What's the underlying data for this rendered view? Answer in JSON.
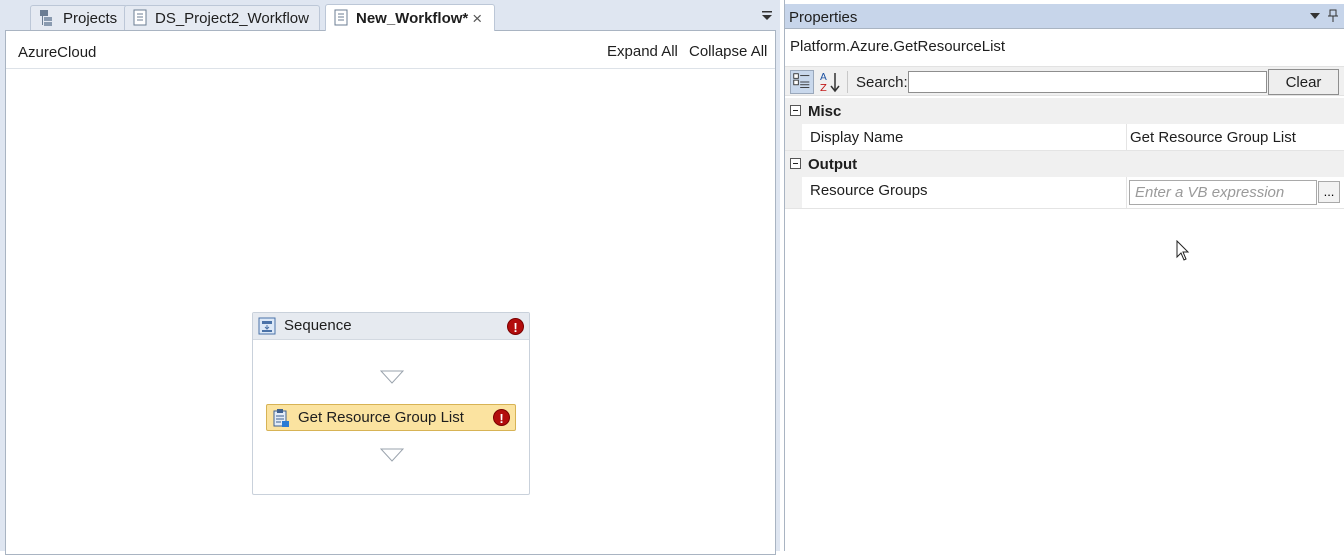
{
  "tabs": [
    {
      "label": "Projects",
      "icon": "project-tree-icon"
    },
    {
      "label": "DS_Project2_Workflow",
      "icon": "workflow-doc-icon"
    },
    {
      "label": "New_Workflow*",
      "icon": "workflow-doc-icon",
      "active": true
    }
  ],
  "tab_close": "×",
  "designer": {
    "breadcrumb": "AzureCloud",
    "expand_all": "Expand All",
    "collapse_all": "Collapse All",
    "sequence": {
      "title": "Sequence",
      "error_glyph": "!",
      "activity": {
        "title": "Get Resource Group List",
        "error_glyph": "!"
      }
    }
  },
  "properties": {
    "title": "Properties",
    "type_name": "Platform.Azure.GetResourceList",
    "search_label": "Search:",
    "search_value": "",
    "clear_label": "Clear",
    "categories": [
      {
        "name": "Misc",
        "props": [
          {
            "name": "Display Name",
            "value": "Get Resource Group List"
          }
        ]
      },
      {
        "name": "Output",
        "props": [
          {
            "name": "Resource Groups",
            "placeholder": "Enter a VB expression",
            "button": "..."
          }
        ]
      }
    ]
  },
  "colors": {
    "title_bar": "#c7d5ea",
    "activity_bg": "#fbe3a0",
    "error_red": "#b30d0d"
  }
}
